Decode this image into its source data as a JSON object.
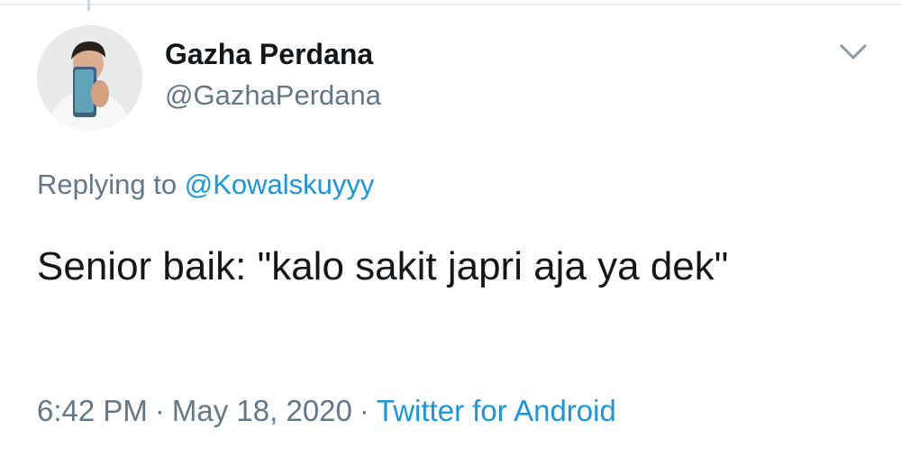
{
  "tweet": {
    "author": {
      "display_name": "Gazha Perdana",
      "handle": "@GazhaPerdana"
    },
    "reply": {
      "prefix": "Replying to",
      "mention": "@Kowalskuyyy"
    },
    "text": "Senior baik: \"kalo sakit japri aja ya dek\"",
    "meta": {
      "time": "6:42 PM",
      "date": "May 18, 2020",
      "separator": "·",
      "source": "Twitter for Android"
    }
  },
  "icons": {
    "menu": "chevron-down-icon",
    "avatar": "avatar"
  },
  "colors": {
    "link": "#1b95e0",
    "secondary_text": "#657786",
    "primary_text": "#14171a"
  }
}
